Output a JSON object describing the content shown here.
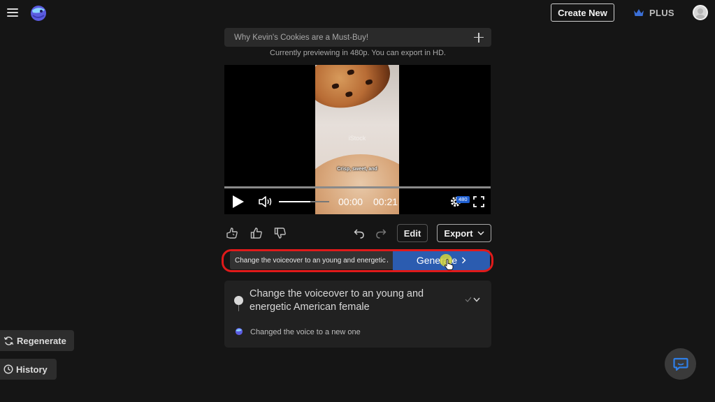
{
  "header": {
    "create_new_label": "Create New",
    "plus_label": "PLUS"
  },
  "project": {
    "title": "Why Kevin's Cookies are a Must-Buy!",
    "preview_note": "Currently previewing in 480p. You can export in HD."
  },
  "player": {
    "watermark": "iStock",
    "caption": "Crisp, sweet, and",
    "current_time": "00:00",
    "duration": "00:21",
    "quality": "480",
    "volume_fraction": 0.62,
    "progress_fraction": 0
  },
  "toolbar": {
    "edit_label": "Edit",
    "export_label": "Export"
  },
  "prompt": {
    "value": "Change the voiceover to an young and energetic American female",
    "generate_label": "Generate"
  },
  "history_item": {
    "request": "Change the voiceover to an young and energetic American female",
    "response": "Changed the voice to a new one"
  },
  "side": {
    "regenerate_label": "Regenerate",
    "history_label": "History"
  },
  "colors": {
    "background": "#151515",
    "accent_blue": "#2b5cb0",
    "highlight_red": "#e01a1a"
  }
}
